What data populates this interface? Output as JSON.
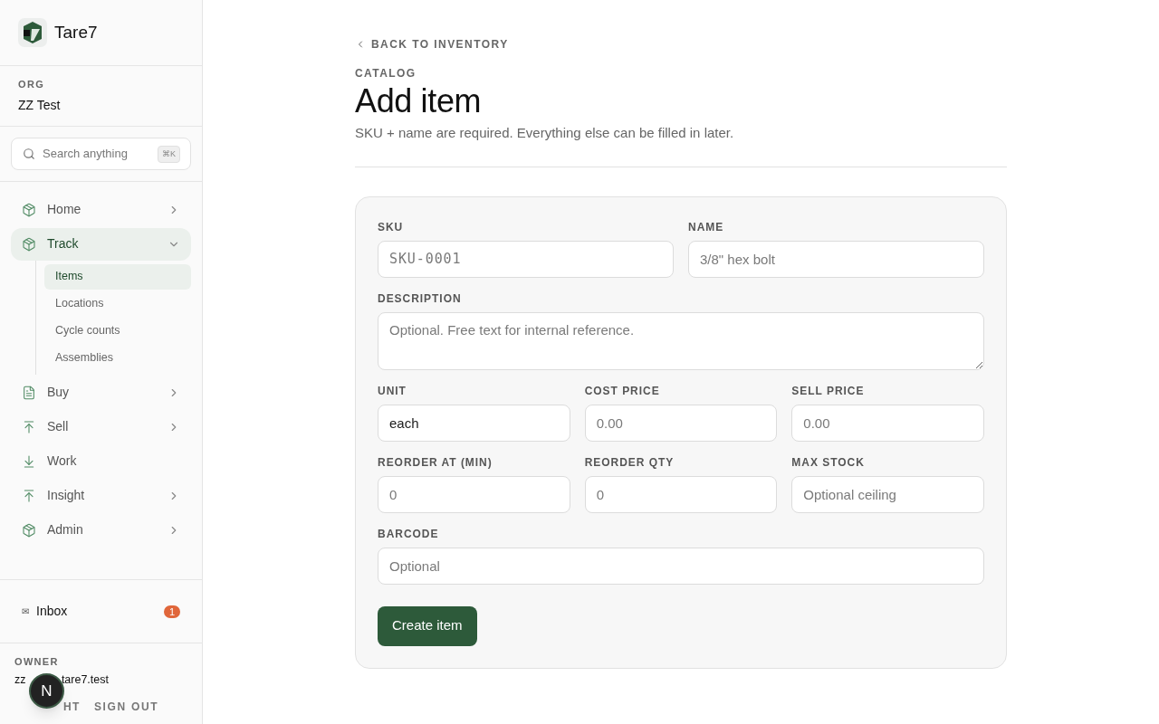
{
  "brand": {
    "name": "Tare7"
  },
  "org": {
    "label": "ORG",
    "name": "ZZ Test"
  },
  "search": {
    "placeholder": "Search anything",
    "shortcut": "⌘K"
  },
  "nav": [
    {
      "label": "Home",
      "kind": "box",
      "expanded": false,
      "has_children": true,
      "selected": false
    },
    {
      "label": "Track",
      "kind": "box",
      "expanded": true,
      "has_children": true,
      "selected": true,
      "children": [
        {
          "label": "Items",
          "selected": true
        },
        {
          "label": "Locations",
          "selected": false
        },
        {
          "label": "Cycle counts",
          "selected": false
        },
        {
          "label": "Assemblies",
          "selected": false
        }
      ]
    },
    {
      "label": "Buy",
      "kind": "doc",
      "expanded": false,
      "has_children": true,
      "selected": false
    },
    {
      "label": "Sell",
      "kind": "up",
      "expanded": false,
      "has_children": true,
      "selected": false
    },
    {
      "label": "Work",
      "kind": "down",
      "has_children": false,
      "selected": false
    },
    {
      "label": "Insight",
      "kind": "up",
      "expanded": false,
      "has_children": true,
      "selected": false
    },
    {
      "label": "Admin",
      "kind": "box",
      "expanded": false,
      "has_children": true,
      "selected": false
    }
  ],
  "inbox": {
    "icon": "✉",
    "label": "Inbox",
    "count": "1"
  },
  "account": {
    "role": "OWNER",
    "email_start": "zz",
    "email_end": "tare7.test",
    "theme_toggle": "HT",
    "sign_out": "SIGN OUT"
  },
  "dev_badge": {
    "letter": "N"
  },
  "page": {
    "back": "BACK TO INVENTORY",
    "eyebrow": "CATALOG",
    "title": "Add item",
    "subtitle": "SKU + name are required. Everything else can be filled in later."
  },
  "form": {
    "rows": [
      [
        {
          "label": "SKU",
          "placeholder": "SKU-0001",
          "kind": "mono"
        },
        {
          "label": "NAME",
          "placeholder": "3/8\" hex bolt",
          "kind": "text"
        }
      ],
      [
        {
          "label": "DESCRIPTION",
          "placeholder": "Optional. Free text for internal reference.",
          "kind": "textarea"
        }
      ],
      [
        {
          "label": "UNIT",
          "value": "each",
          "kind": "text"
        },
        {
          "label": "COST PRICE",
          "placeholder": "0.00",
          "kind": "text"
        },
        {
          "label": "SELL PRICE",
          "placeholder": "0.00",
          "kind": "text"
        }
      ],
      [
        {
          "label": "REORDER AT (MIN)",
          "placeholder": "0",
          "kind": "text"
        },
        {
          "label": "REORDER QTY",
          "placeholder": "0",
          "kind": "text"
        },
        {
          "label": "MAX STOCK",
          "placeholder": "Optional ceiling",
          "kind": "text"
        }
      ],
      [
        {
          "label": "BARCODE",
          "placeholder": "Optional",
          "kind": "text"
        }
      ]
    ],
    "submit": "Create item"
  }
}
